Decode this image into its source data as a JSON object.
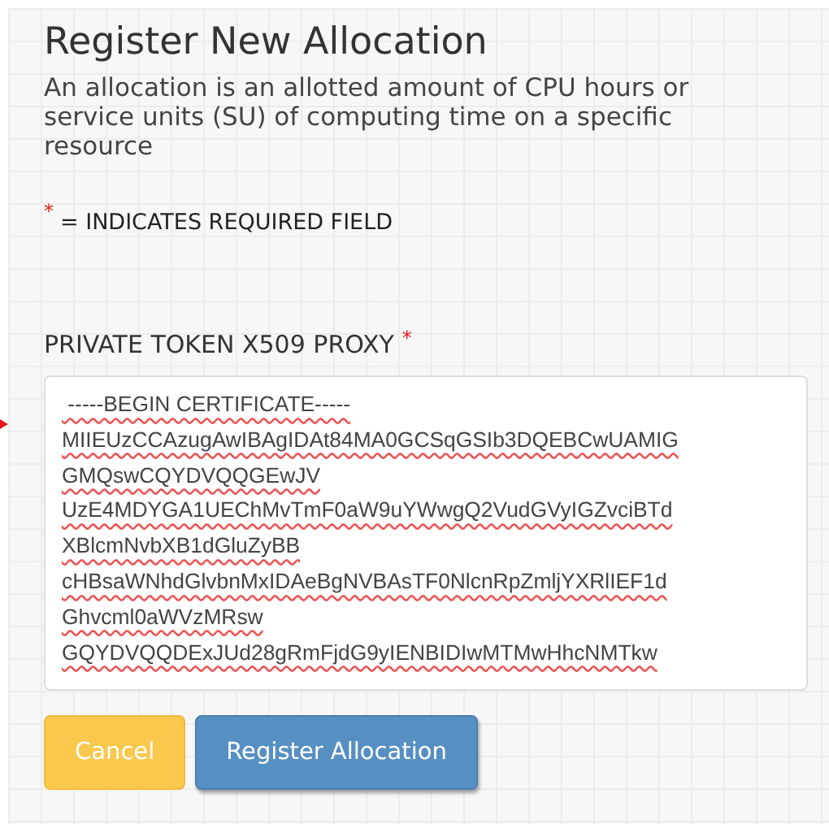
{
  "title": "Register New Allocation",
  "description": "An allocation is an allotted amount of CPU hours or service units (SU) of computing time on a specific resource",
  "required_note": {
    "marker": "*",
    "text": "= INDICATES REQUIRED FIELD"
  },
  "fields": [
    {
      "label": "PRIVATE TOKEN X509 PROXY",
      "required": true,
      "value_lines": [
        " -----BEGIN CERTIFICATE-----",
        "MIIEUzCCAzugAwIBAgIDAt84MA0GCSqGSIb3DQEBCwUAMIG",
        "GMQswCQYDVQQGEwJV",
        "UzE4MDYGA1UEChMvTmF0aW9uYWwgQ2VudGVyIGZvciBTd",
        "XBlcmNvbXB1dGluZyBB",
        "cHBsaWNhdGlvbnMxIDAeBgNVBAsTF0NlcnRpZmljYXRlIEF1d",
        "Ghvcml0aWVzMRsw",
        "GQYDVQQDExJUd28gRmFjdG9yIENBIDIwMTMwHhcNMTkw"
      ]
    }
  ],
  "buttons": [
    {
      "label": "Cancel",
      "kind": "warning"
    },
    {
      "label": "Register Allocation",
      "kind": "primary"
    }
  ]
}
